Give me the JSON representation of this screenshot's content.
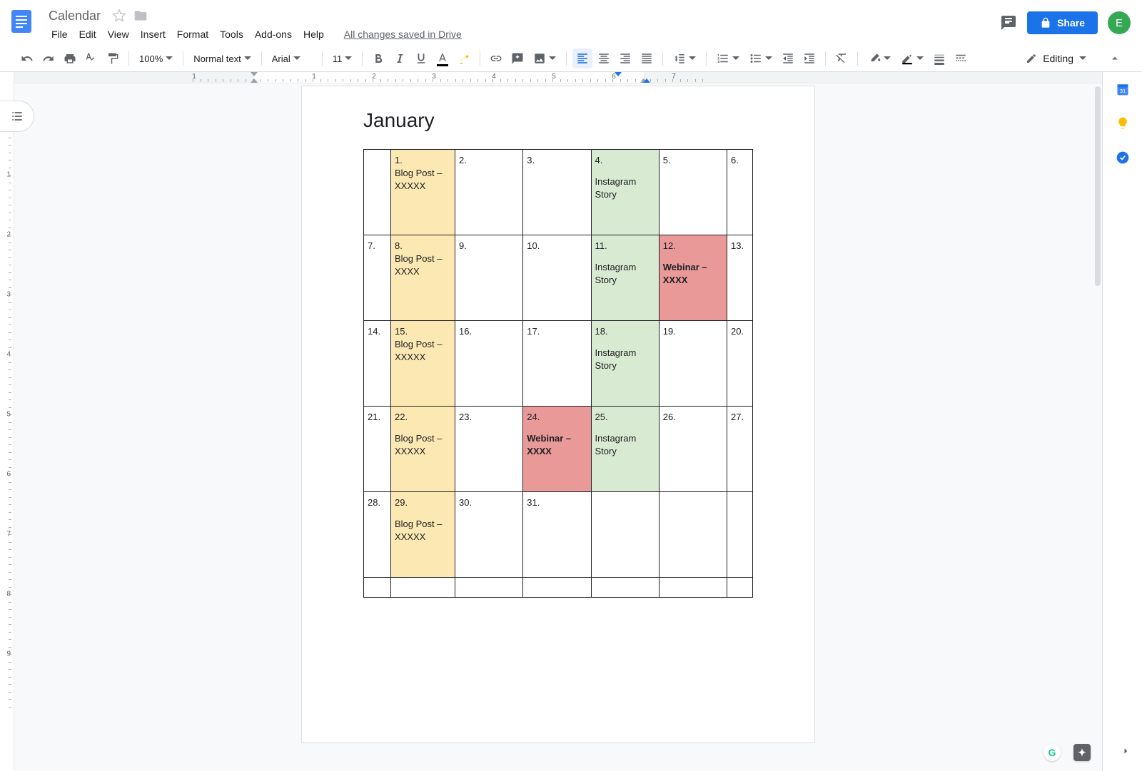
{
  "header": {
    "title": "Calendar",
    "menus": [
      "File",
      "Edit",
      "View",
      "Insert",
      "Format",
      "Tools",
      "Add-ons",
      "Help"
    ],
    "save_status": "All changes saved in Drive",
    "share_label": "Share",
    "avatar_initial": "E"
  },
  "toolbar": {
    "zoom": "100%",
    "style": "Normal text",
    "font": "Arial",
    "size": "11",
    "mode_label": "Editing"
  },
  "doc": {
    "heading": "January",
    "rows": [
      [
        {
          "date": "",
          "content": "",
          "color": "",
          "bold": false
        },
        {
          "date": "1.",
          "content": "Blog Post  – XXXXX",
          "color": "yellow",
          "bold": false
        },
        {
          "date": "2.",
          "content": "",
          "color": "",
          "bold": false
        },
        {
          "date": "3.",
          "content": "",
          "color": "",
          "bold": false
        },
        {
          "date": "4.",
          "content": "Instagram Story",
          "color": "green",
          "bold": false,
          "spaced": true
        },
        {
          "date": "5.",
          "content": "",
          "color": "",
          "bold": false
        },
        {
          "date": "6.",
          "content": "",
          "color": "",
          "bold": false
        }
      ],
      [
        {
          "date": "7.",
          "content": "",
          "color": "",
          "bold": false
        },
        {
          "date": "8.",
          "content": "Blog Post  – XXXX",
          "color": "yellow",
          "bold": false
        },
        {
          "date": "9.",
          "content": "",
          "color": "",
          "bold": false
        },
        {
          "date": "10.",
          "content": "",
          "color": "",
          "bold": false
        },
        {
          "date": "11.",
          "content": "Instagram Story",
          "color": "green",
          "bold": false,
          "spaced": true
        },
        {
          "date": "12.",
          "content": "Webinar – XXXX",
          "color": "red",
          "bold": true,
          "spaced": true
        },
        {
          "date": "13.",
          "content": "",
          "color": "",
          "bold": false
        }
      ],
      [
        {
          "date": "14.",
          "content": "",
          "color": "",
          "bold": false
        },
        {
          "date": "15.",
          "content": "Blog Post  – XXXXX",
          "color": "yellow",
          "bold": false
        },
        {
          "date": "16.",
          "content": "",
          "color": "",
          "bold": false
        },
        {
          "date": "17.",
          "content": "",
          "color": "",
          "bold": false
        },
        {
          "date": "18.",
          "content": "Instagram Story",
          "color": "green",
          "bold": false,
          "spaced": true
        },
        {
          "date": "19.",
          "content": "",
          "color": "",
          "bold": false
        },
        {
          "date": "20.",
          "content": "",
          "color": "",
          "bold": false
        }
      ],
      [
        {
          "date": "21.",
          "content": "",
          "color": "",
          "bold": false
        },
        {
          "date": "22.",
          "content": "Blog Post  – XXXXX",
          "color": "yellow",
          "bold": false,
          "spaced": true
        },
        {
          "date": "23.",
          "content": "",
          "color": "",
          "bold": false
        },
        {
          "date": "24.",
          "content": "Webinar – XXXX",
          "color": "red",
          "bold": true,
          "spaced": true
        },
        {
          "date": "25.",
          "content": "Instagram Story",
          "color": "green",
          "bold": false,
          "spaced": true
        },
        {
          "date": "26.",
          "content": "",
          "color": "",
          "bold": false
        },
        {
          "date": "27.",
          "content": "",
          "color": "",
          "bold": false
        }
      ],
      [
        {
          "date": "28.",
          "content": "",
          "color": "",
          "bold": false
        },
        {
          "date": "29.",
          "content": "Blog Post  – XXXXX",
          "color": "yellow",
          "bold": false,
          "spaced": true
        },
        {
          "date": "30.",
          "content": "",
          "color": "",
          "bold": false
        },
        {
          "date": "31.",
          "content": "",
          "color": "",
          "bold": false
        },
        {
          "date": "",
          "content": "",
          "color": "",
          "bold": false
        },
        {
          "date": "",
          "content": "",
          "color": "",
          "bold": false
        },
        {
          "date": "",
          "content": "",
          "color": "",
          "bold": false
        }
      ]
    ]
  },
  "ruler": {
    "h_labels": [
      "1",
      "2",
      "3",
      "4",
      "5",
      "6",
      "7"
    ],
    "v_labels": [
      "1",
      "2",
      "3",
      "4",
      "5",
      "6",
      "7",
      "8",
      "9"
    ]
  }
}
